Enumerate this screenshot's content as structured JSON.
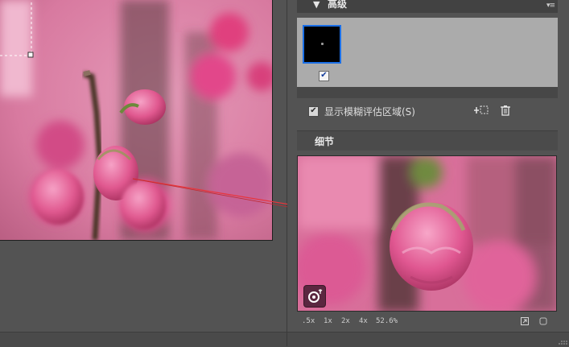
{
  "advanced": {
    "title": "高级",
    "collapse_arrow": "▼",
    "menu_glyph": "▾≡",
    "thumbnail_checked": true,
    "check_glyph": "✔"
  },
  "blur_region": {
    "label": "显示模糊评估区域(S)",
    "checked": true,
    "add_icon": "plus-marquee-icon",
    "delete_icon": "trash-icon"
  },
  "detail": {
    "title": "细节",
    "zoom_levels": [
      ".5x",
      "1x",
      "2x",
      "4x"
    ],
    "zoom_value": "52.6%"
  },
  "colors": {
    "panel_bg": "#535353",
    "accent_blue": "#1b6fe6",
    "photo_pink": "#e8649c",
    "leader_line": "#e8353c",
    "pin_button": "#5b2740"
  }
}
